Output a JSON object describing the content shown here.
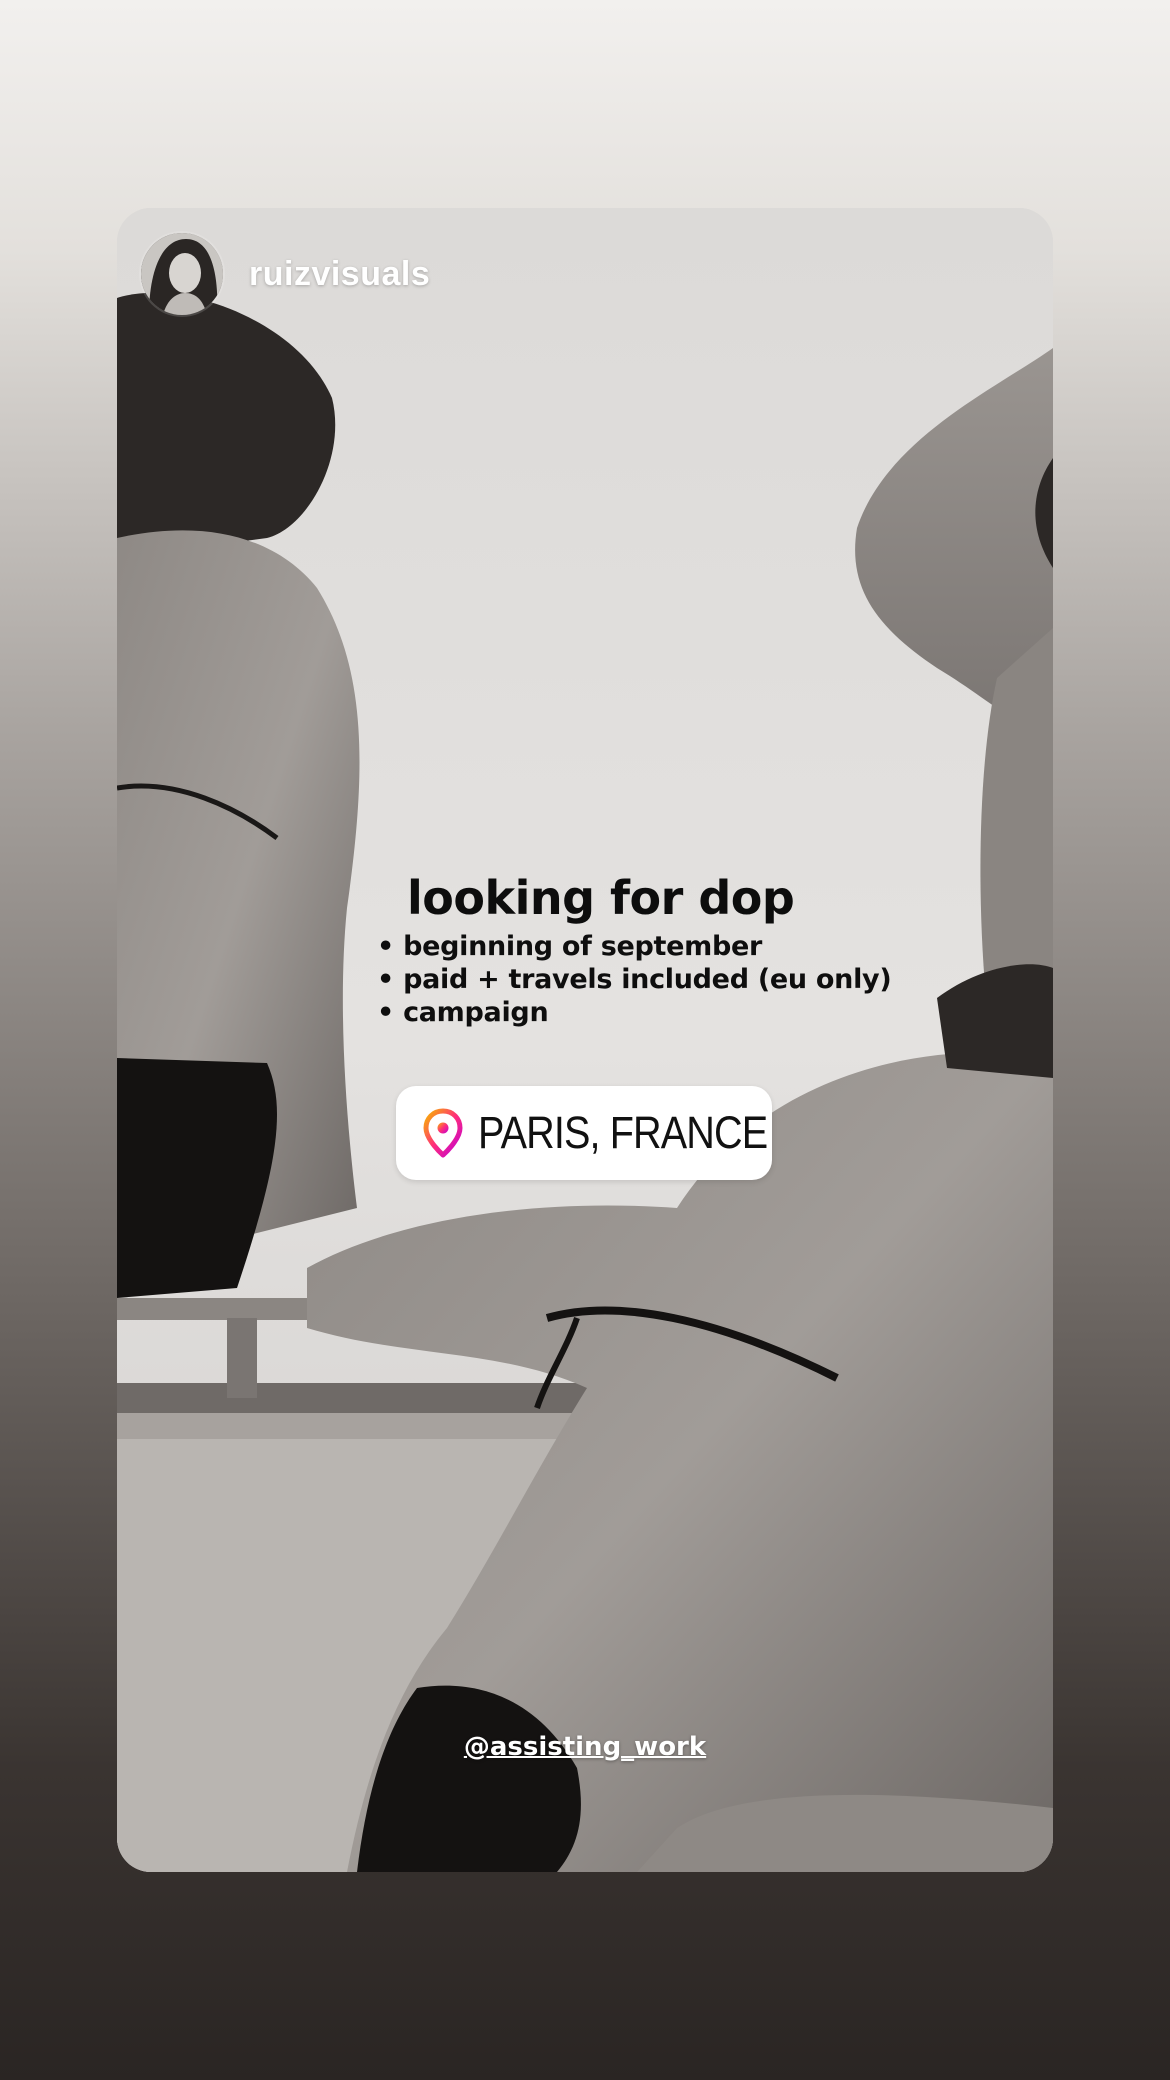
{
  "story": {
    "username": "ruizvisuals",
    "headline": "looking for dop",
    "bullets": [
      "beginning of september",
      "paid + travels included (eu only)",
      "campaign"
    ],
    "location": {
      "label": "PARIS, FRANCE",
      "icon": "location-pin-icon"
    },
    "mention": "@assisting_work"
  },
  "colors": {
    "background_top": "#f2f0ee",
    "background_bottom": "#2a2523",
    "sticker_bg": "#ffffff",
    "pin_gradient_start": "#f7b500",
    "pin_gradient_end": "#c000d6"
  }
}
